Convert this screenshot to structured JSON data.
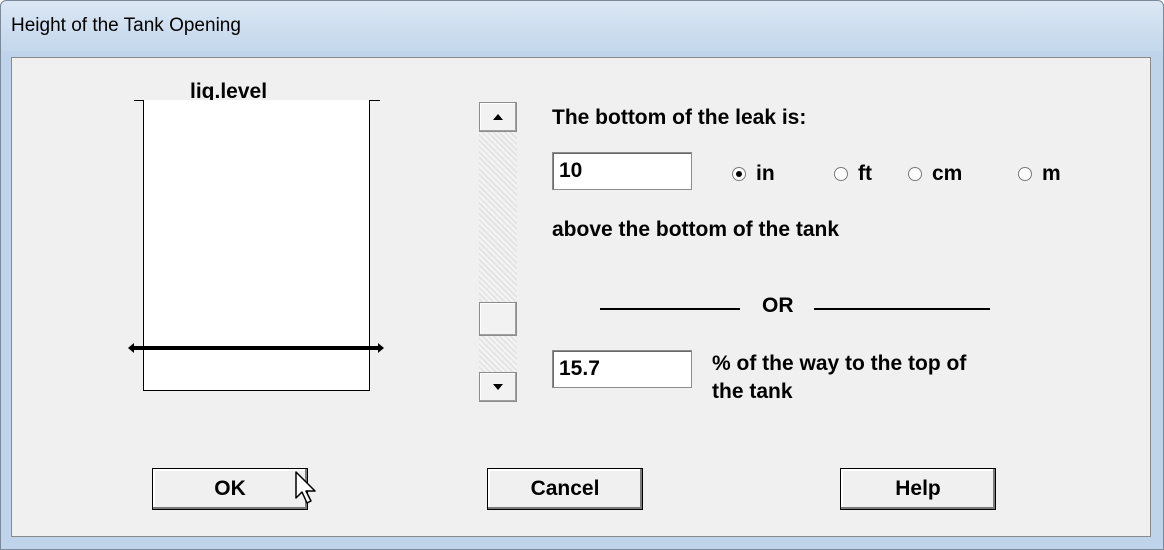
{
  "window": {
    "title": "Height of the Tank Opening"
  },
  "diagram": {
    "liq_label": "liq.level"
  },
  "main": {
    "bottom_label": "The bottom of the leak is:",
    "bottom_value": "10",
    "units": [
      {
        "label": "in",
        "selected": true
      },
      {
        "label": "ft",
        "selected": false
      },
      {
        "label": "cm",
        "selected": false
      },
      {
        "label": "m",
        "selected": false
      }
    ],
    "above_label": "above the bottom of the tank",
    "or_label": "OR",
    "percent_value": "15.7",
    "percent_label_line1": "% of the way to the top of",
    "percent_label_line2": "the tank"
  },
  "buttons": {
    "ok": "OK",
    "cancel": "Cancel",
    "help": "Help"
  },
  "icons": {
    "scroll_up": "arrow-up-icon",
    "scroll_down": "arrow-down-icon",
    "cursor": "mouse-pointer-icon"
  }
}
